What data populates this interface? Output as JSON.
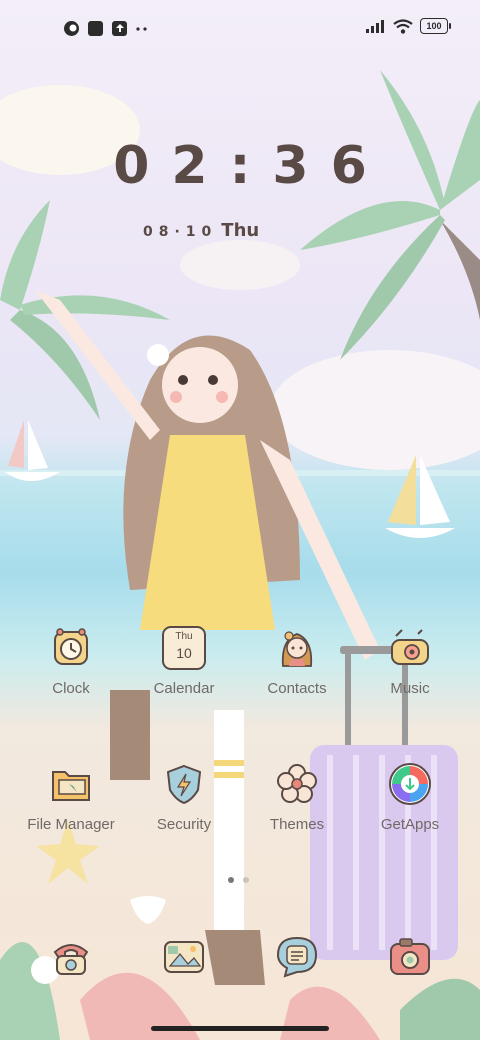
{
  "status_bar": {
    "battery": "100",
    "left_icons": [
      "app-notification-icon",
      "square-notification-icon",
      "upload-notification-icon",
      "more-dots-icon"
    ],
    "right_icons": [
      "signal-icon",
      "wifi-icon",
      "battery-icon"
    ]
  },
  "lockclock": {
    "time": "02:36",
    "date": "08·10",
    "weekday": "Thu"
  },
  "apps_row1": [
    {
      "label": "Clock",
      "icon": "alarm-clock-icon"
    },
    {
      "label": "Calendar",
      "icon": "calendar-icon",
      "day": "Thu",
      "date": "10"
    },
    {
      "label": "Contacts",
      "icon": "contacts-girl-icon"
    },
    {
      "label": "Music",
      "icon": "music-radio-icon"
    }
  ],
  "apps_row2": [
    {
      "label": "File Manager",
      "icon": "folder-icon"
    },
    {
      "label": "Security",
      "icon": "shield-icon"
    },
    {
      "label": "Themes",
      "icon": "flower-icon"
    },
    {
      "label": "GetApps",
      "icon": "getapps-icon"
    }
  ],
  "page_indicator": {
    "pages": 2,
    "active": 1
  },
  "dock": [
    {
      "icon": "phone-icon"
    },
    {
      "icon": "gallery-icon"
    },
    {
      "icon": "messages-icon"
    },
    {
      "icon": "camera-icon"
    }
  ],
  "colors": {
    "clock_text": "#5a4a45",
    "label_text": "#6f6a67",
    "sea": "#a7dceb",
    "sky": "#ece6f6"
  }
}
